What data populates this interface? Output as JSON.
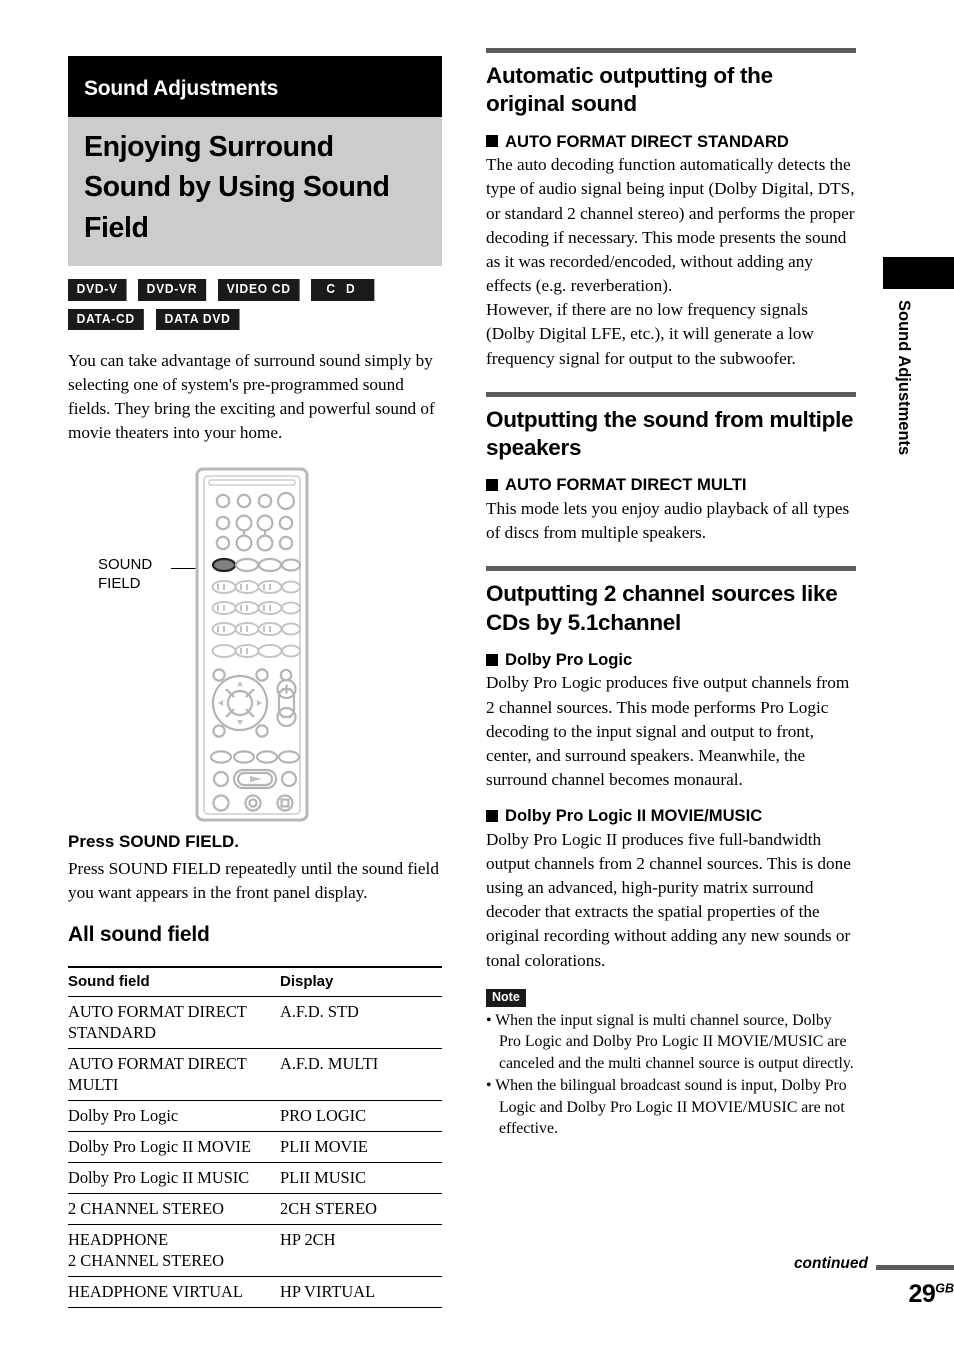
{
  "left": {
    "chapter_band": "Sound Adjustments",
    "page_title": "Enjoying Surround Sound by Using Sound Field",
    "media_badges": [
      {
        "label": "DVD-V"
      },
      {
        "label": "DVD-VR"
      },
      {
        "label": "VIDEO CD"
      },
      {
        "label": "C D"
      },
      {
        "label": "DATA-CD"
      },
      {
        "label": "DATA DVD"
      }
    ],
    "intro_paragraph": "You can take advantage of surround sound simply by selecting one of system's pre-programmed sound fields. They bring the exciting and powerful sound of movie theaters into your home.",
    "figure": {
      "callout_label_line1": "SOUND",
      "callout_label_line2": "FIELD"
    },
    "press_heading": "Press SOUND FIELD.",
    "press_body": "Press SOUND FIELD repeatedly until the sound field you want appears in the front panel display.",
    "subheading": "All sound field",
    "table": {
      "headers": [
        "Sound field",
        "Display"
      ],
      "rows": [
        {
          "sound_field": "AUTO FORMAT DIRECT STANDARD",
          "display": "A.F.D. STD"
        },
        {
          "sound_field": "AUTO FORMAT DIRECT MULTI",
          "display": "A.F.D. MULTI"
        },
        {
          "sound_field": "Dolby Pro Logic",
          "display": "PRO LOGIC"
        },
        {
          "sound_field": "Dolby Pro Logic II MOVIE",
          "display": "PLII MOVIE"
        },
        {
          "sound_field": "Dolby Pro Logic II MUSIC",
          "display": "PLII MUSIC"
        },
        {
          "sound_field": "2 CHANNEL STEREO",
          "display": "2CH STEREO"
        },
        {
          "sound_field": "HEADPHONE\n2 CHANNEL STEREO",
          "display": "HP 2CH"
        },
        {
          "sound_field": "HEADPHONE VIRTUAL",
          "display": "HP VIRTUAL"
        }
      ]
    }
  },
  "right": {
    "section1": {
      "heading": "Automatic outputting of the original sound",
      "sub_heading": "AUTO FORMAT DIRECT STANDARD",
      "paragraph1": "The auto decoding function automatically detects the type of audio signal being input (Dolby Digital, DTS, or standard 2 channel stereo) and performs the proper decoding if necessary. This mode presents the sound as it was recorded/encoded, without adding any effects (e.g. reverberation).",
      "paragraph2": "However, if there are no low frequency signals (Dolby Digital LFE, etc.), it will generate a low frequency signal for output to the subwoofer."
    },
    "section2": {
      "heading": "Outputting the sound from multiple speakers",
      "sub_heading": "AUTO FORMAT DIRECT MULTI",
      "paragraph1": "This mode lets you enjoy audio playback of all types of discs from multiple speakers."
    },
    "section3": {
      "heading": "Outputting 2 channel sources like CDs by 5.1channel",
      "sub_heading_a": "Dolby Pro Logic",
      "paragraph_a": "Dolby Pro Logic produces five output channels from 2 channel sources. This mode performs Pro Logic decoding to the input signal and output to front, center, and surround speakers. Meanwhile, the surround channel becomes monaural.",
      "sub_heading_b": "Dolby Pro Logic II MOVIE/MUSIC",
      "paragraph_b": "Dolby Pro Logic II produces five full-bandwidth output channels from 2 channel sources. This is done using an advanced, high-purity matrix surround decoder that extracts the spatial properties of the original recording without adding any new sounds or tonal colorations."
    },
    "note": {
      "badge": "Note",
      "items": [
        "When the input signal is multi channel source, Dolby Pro Logic and Dolby Pro Logic II MOVIE/MUSIC are canceled and the multi channel source is output directly.",
        "When the bilingual broadcast sound is input, Dolby Pro Logic and Dolby Pro Logic II MOVIE/MUSIC are not effective."
      ]
    }
  },
  "side_tab": {
    "label": "Sound Adjustments"
  },
  "footer": {
    "continued": "continued",
    "page_number": "29",
    "page_suffix": "GB"
  },
  "colors": {
    "band_black": "#000000",
    "title_gray": "#cccccc",
    "rule_gray": "#5d5d5d",
    "remote_gray": "#b4b4b4"
  }
}
